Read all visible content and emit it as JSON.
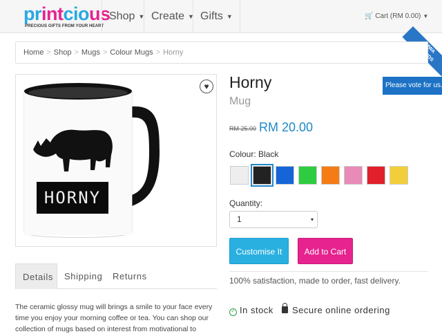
{
  "brand": {
    "logo_parts": [
      {
        "text": "pr",
        "color": "#2aa8e0"
      },
      {
        "text": "int",
        "color": "#e6238f"
      },
      {
        "text": "cio",
        "color": "#2aa8e0"
      },
      {
        "text": "us",
        "color": "#e6238f"
      }
    ],
    "tagline": "PRECIOUS GIFTS FROM YOUR HEART"
  },
  "nav": {
    "items": [
      {
        "label": "Shop"
      },
      {
        "label": "Create"
      },
      {
        "label": "Gifts"
      }
    ],
    "cart_label": "Cart (RM 0.00)"
  },
  "ribbon": {
    "line1": "MWA",
    "line2": "AWARDS"
  },
  "breadcrumb": [
    "Home",
    "Shop",
    "Mugs",
    "Colour Mugs",
    "Horny"
  ],
  "product": {
    "title": "Horny",
    "subtitle": "Mug",
    "vote_label": "Please vote for us. ^",
    "price_old": "RM 25.00",
    "price_new": "RM 20.00",
    "colour_label": "Colour: Black",
    "swatches": [
      {
        "name": "white",
        "color": "#eeeeee"
      },
      {
        "name": "black",
        "color": "#222222",
        "selected": true
      },
      {
        "name": "blue",
        "color": "#1565d8"
      },
      {
        "name": "green",
        "color": "#2ecc40"
      },
      {
        "name": "orange",
        "color": "#f57c14"
      },
      {
        "name": "pink",
        "color": "#e88bb6"
      },
      {
        "name": "red",
        "color": "#e0202a"
      },
      {
        "name": "yellow",
        "color": "#f2cf3a"
      }
    ],
    "quantity_label": "Quantity:",
    "quantity_value": "1",
    "customise_label": "Customise It",
    "cart_button_label": "Add to Cart",
    "satisfaction": "100% satisfaction, made to order, fast delivery.",
    "in_stock": "In stock",
    "secure": "Secure online ordering",
    "mug_text": "HORNY"
  },
  "tabs": [
    {
      "label": "Details",
      "active": true
    },
    {
      "label": "Shipping"
    },
    {
      "label": "Returns"
    }
  ],
  "description": "The ceramic glossy mug will brings a smile to your face every time you enjoy your morning coffee or tea. You can shop our collection of mugs based on interest from motivational to humorous, create your"
}
